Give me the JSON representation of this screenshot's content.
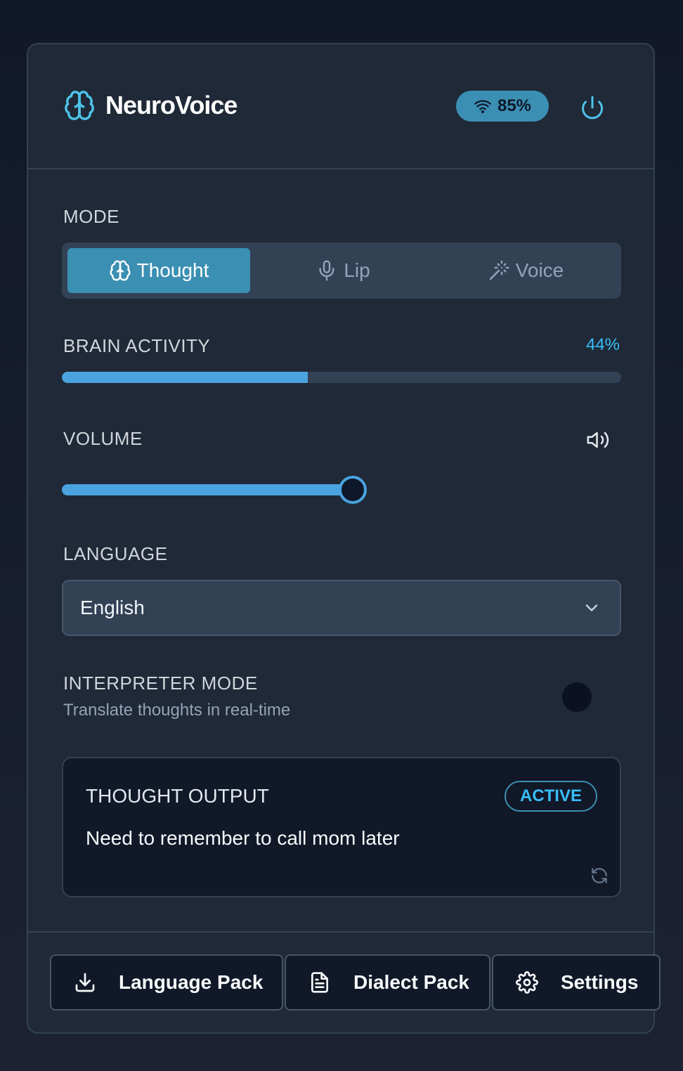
{
  "app": {
    "name": "NeuroVoice",
    "signal": "85%"
  },
  "mode": {
    "label": "MODE",
    "options": [
      {
        "label": "Thought",
        "icon": "brain-icon",
        "active": true
      },
      {
        "label": "Lip",
        "icon": "mic-icon",
        "active": false
      },
      {
        "label": "Voice",
        "icon": "magic-wand-icon",
        "active": false
      }
    ]
  },
  "activity": {
    "label": "BRAIN ACTIVITY",
    "value_text": "44%",
    "value": 0.44
  },
  "volume": {
    "label": "VOLUME",
    "value": 0.52
  },
  "language": {
    "label": "LANGUAGE",
    "selected": "English"
  },
  "interpreter": {
    "label": "INTERPRETER MODE",
    "description": "Translate thoughts in real-time",
    "enabled": false
  },
  "output": {
    "title": "THOUGHT OUTPUT",
    "status": "ACTIVE",
    "text": "Need to remember to call mom later"
  },
  "footer": {
    "buttons": [
      {
        "label": "Language Pack",
        "icon": "download-icon"
      },
      {
        "label": "Dialect Pack",
        "icon": "document-icon"
      },
      {
        "label": "Settings",
        "icon": "gear-icon"
      }
    ]
  },
  "colors": {
    "accent": "#3b8fb3",
    "bar": "#4aa3df",
    "highlight": "#38bdf8"
  }
}
